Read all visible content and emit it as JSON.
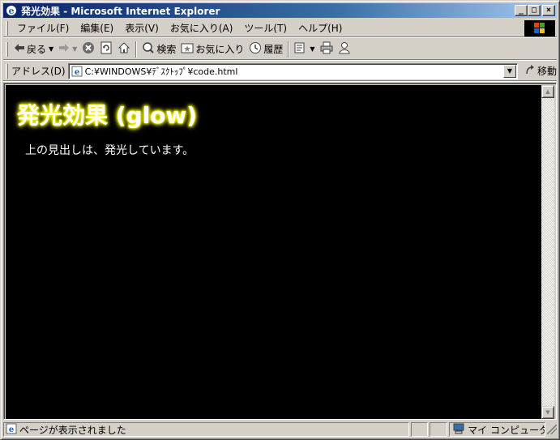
{
  "window": {
    "title": "発光効果 - Microsoft Internet Explorer",
    "min_glyph": "_",
    "max_glyph": "□",
    "close_glyph": "×"
  },
  "menu": {
    "items": [
      {
        "label": "ファイル(F)"
      },
      {
        "label": "編集(E)"
      },
      {
        "label": "表示(V)"
      },
      {
        "label": "お気に入り(A)"
      },
      {
        "label": "ツール(T)"
      },
      {
        "label": "ヘルプ(H)"
      }
    ]
  },
  "toolbar": {
    "back_label": "戻る",
    "search_label": "検索",
    "favorites_label": "お気に入り",
    "history_label": "履歴"
  },
  "address": {
    "label": "アドレス(D)",
    "url": "C:¥WINDOWS¥ﾃﾞｽｸﾄｯﾌﾟ¥code.html",
    "go_label": "移動"
  },
  "page": {
    "heading": "発光効果 (glow)",
    "body": "上の見出しは、発光しています。"
  },
  "status": {
    "text": "ページが表示されました",
    "zone": "マイ コンピュータ"
  },
  "colors": {
    "titlebar_start": "#0a246a",
    "titlebar_end": "#a6caf0",
    "chrome": "#d4d0c8",
    "content_bg": "#000000",
    "glow": "#ffff00",
    "heading_text": "#ffffff"
  }
}
